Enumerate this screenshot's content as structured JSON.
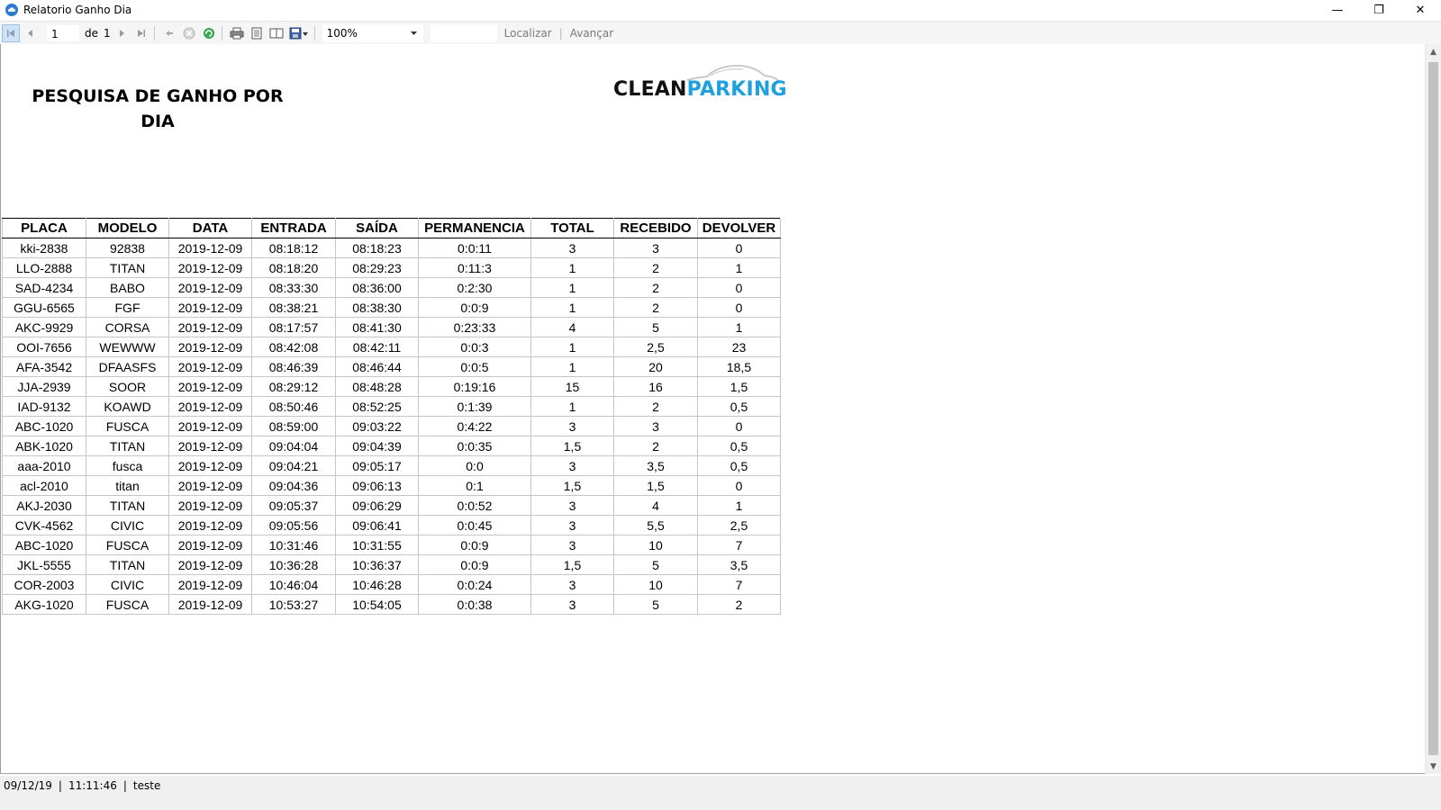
{
  "window": {
    "title": "Relatorio Ganho Dia",
    "app_icon": "car-icon",
    "controls": {
      "minimize": "—",
      "maximize": "❐",
      "close": "✕"
    }
  },
  "toolbar": {
    "page_current": "1",
    "of_label": "de",
    "page_total": "1",
    "zoom": "100%",
    "search_value": "",
    "find_label": "Localizar",
    "next_label": "Avançar",
    "separator": "|",
    "icons": [
      "first-page-icon",
      "previous-page-icon",
      "next-page-icon",
      "last-page-icon",
      "back-icon",
      "stop-icon",
      "refresh-icon",
      "print-icon",
      "print-layout-icon",
      "page-setup-icon",
      "export-icon"
    ]
  },
  "report": {
    "title": "PESQUISA DE GANHO POR DIA",
    "logo": {
      "part1": "CLEAN",
      "part2": "PARKING",
      "color1": "#111111",
      "color2": "#1e9fe0"
    },
    "columns": [
      "PLACA",
      "MODELO",
      "DATA",
      "ENTRADA",
      "SAÍDA",
      "PERMANENCIA",
      "TOTAL",
      "RECEBIDO",
      "DEVOLVER"
    ],
    "rows": [
      [
        "kki-2838",
        "92838",
        "2019-12-09",
        "08:18:12",
        "08:18:23",
        "0:0:11",
        "3",
        "3",
        "0"
      ],
      [
        "LLO-2888",
        "TITAN",
        "2019-12-09",
        "08:18:20",
        "08:29:23",
        "0:11:3",
        "1",
        "2",
        "1"
      ],
      [
        "SAD-4234",
        "BABO",
        "2019-12-09",
        "08:33:30",
        "08:36:00",
        "0:2:30",
        "1",
        "2",
        "0"
      ],
      [
        "GGU-6565",
        "FGF",
        "2019-12-09",
        "08:38:21",
        "08:38:30",
        "0:0:9",
        "1",
        "2",
        "0"
      ],
      [
        "AKC-9929",
        "CORSA",
        "2019-12-09",
        "08:17:57",
        "08:41:30",
        "0:23:33",
        "4",
        "5",
        "1"
      ],
      [
        "OOI-7656",
        "WEWWW",
        "2019-12-09",
        "08:42:08",
        "08:42:11",
        "0:0:3",
        "1",
        "2,5",
        "23"
      ],
      [
        "AFA-3542",
        "DFAASFS",
        "2019-12-09",
        "08:46:39",
        "08:46:44",
        "0:0:5",
        "1",
        "20",
        "18,5"
      ],
      [
        "JJA-2939",
        "SOOR",
        "2019-12-09",
        "08:29:12",
        "08:48:28",
        "0:19:16",
        "15",
        "16",
        "1,5"
      ],
      [
        "IAD-9132",
        "KOAWD",
        "2019-12-09",
        "08:50:46",
        "08:52:25",
        "0:1:39",
        "1",
        "2",
        "0,5"
      ],
      [
        "ABC-1020",
        "FUSCA",
        "2019-12-09",
        "08:59:00",
        "09:03:22",
        "0:4:22",
        "3",
        "3",
        "0"
      ],
      [
        "ABK-1020",
        "TITAN",
        "2019-12-09",
        "09:04:04",
        "09:04:39",
        "0:0:35",
        "1,5",
        "2",
        "0,5"
      ],
      [
        "aaa-2010",
        "fusca",
        "2019-12-09",
        "09:04:21",
        "09:05:17",
        "0:0",
        "3",
        "3,5",
        "0,5"
      ],
      [
        "acl-2010",
        "titan",
        "2019-12-09",
        "09:04:36",
        "09:06:13",
        "0:1",
        "1,5",
        "1,5",
        "0"
      ],
      [
        "AKJ-2030",
        "TITAN",
        "2019-12-09",
        "09:05:37",
        "09:06:29",
        "0:0:52",
        "3",
        "4",
        "1"
      ],
      [
        "CVK-4562",
        "CIVIC",
        "2019-12-09",
        "09:05:56",
        "09:06:41",
        "0:0:45",
        "3",
        "5,5",
        "2,5"
      ],
      [
        "ABC-1020",
        "FUSCA",
        "2019-12-09",
        "10:31:46",
        "10:31:55",
        "0:0:9",
        "3",
        "10",
        "7"
      ],
      [
        "JKL-5555",
        "TITAN",
        "2019-12-09",
        "10:36:28",
        "10:36:37",
        "0:0:9",
        "1,5",
        "5",
        "3,5"
      ],
      [
        "COR-2003",
        "CIVIC",
        "2019-12-09",
        "10:46:04",
        "10:46:28",
        "0:0:24",
        "3",
        "10",
        "7"
      ],
      [
        "AKG-1020",
        "FUSCA",
        "2019-12-09",
        "10:53:27",
        "10:54:05",
        "0:0:38",
        "3",
        "5",
        "2"
      ]
    ]
  },
  "statusbar": {
    "date": "09/12/19",
    "time": "11:11:46",
    "user": "teste",
    "separator": "|"
  }
}
